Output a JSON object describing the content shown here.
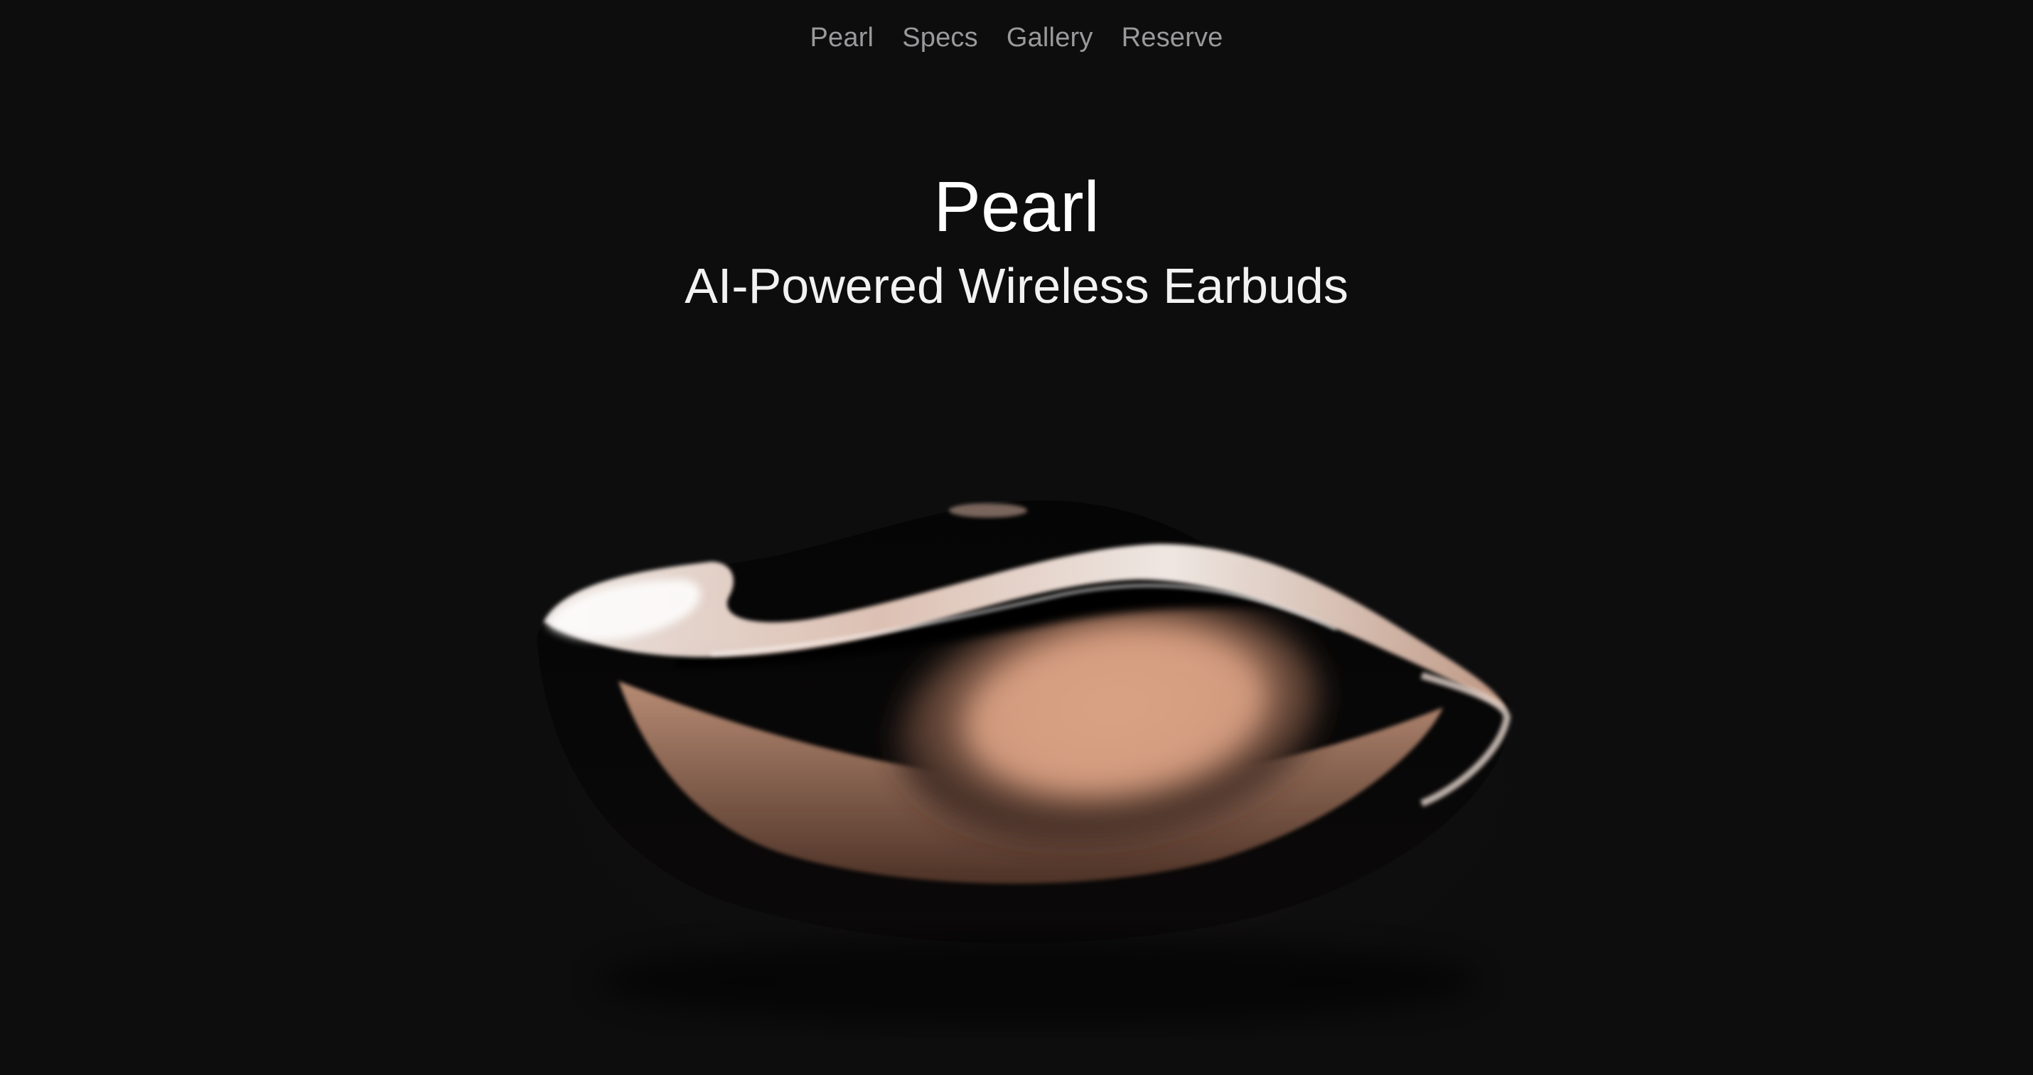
{
  "nav": {
    "items": [
      {
        "label": "Pearl"
      },
      {
        "label": "Specs"
      },
      {
        "label": "Gallery"
      },
      {
        "label": "Reserve"
      }
    ]
  },
  "hero": {
    "title": "Pearl",
    "subtitle": "AI-Powered Wireless Earbuds"
  },
  "colors": {
    "background": "#0d0d0e",
    "nav_text": "#9a9a9c",
    "accent_rose": "#d9a184"
  }
}
